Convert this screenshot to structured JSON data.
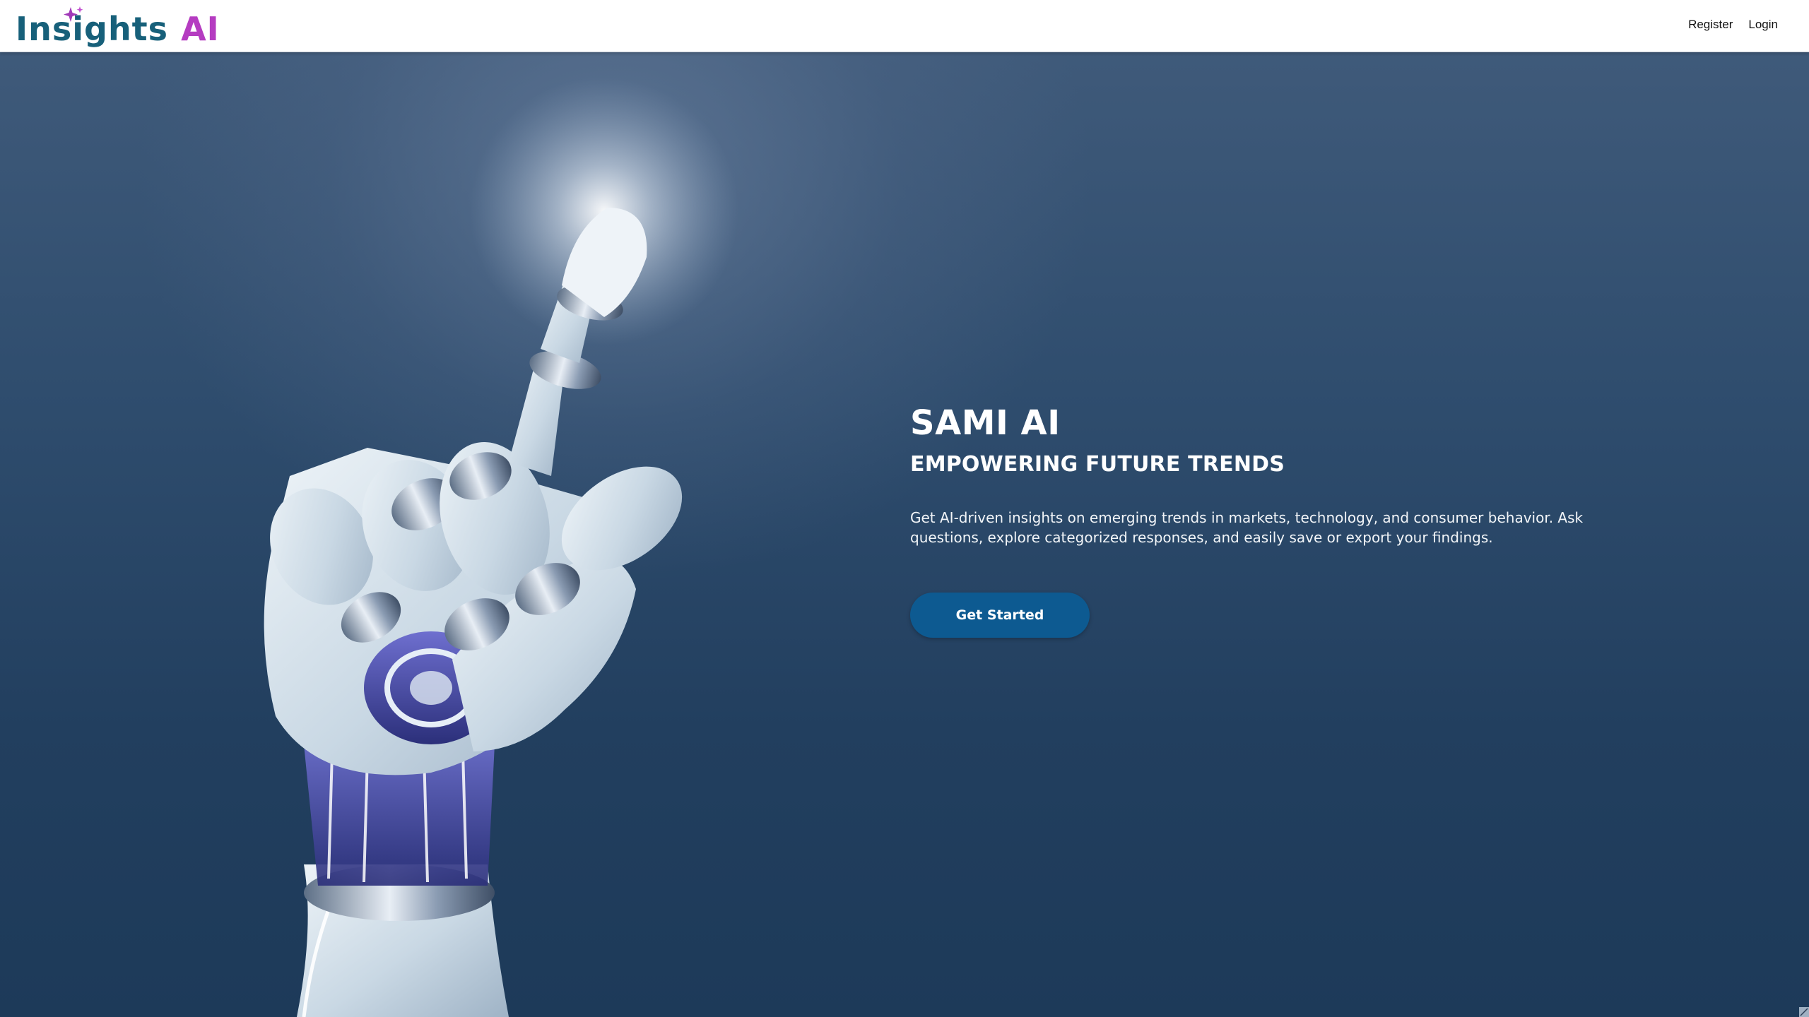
{
  "navbar": {
    "logo": {
      "word": "Insights",
      "accent": "AI",
      "word_color": "#17607a",
      "accent_color": "#b53cc1",
      "icon": "sparkle-icon"
    },
    "links": [
      {
        "label": "Register"
      },
      {
        "label": "Login"
      }
    ]
  },
  "hero": {
    "title": "SAMI AI",
    "subtitle": "EMPOWERING FUTURE TRENDS",
    "description": "Get AI-driven insights on emerging trends in markets, technology, and consumer behavior. Ask questions, explore categorized responses, and easily save or export your findings.",
    "cta_label": "Get Started",
    "cta_color": "#0d5a91",
    "background_colors": [
      "#3f5a7a",
      "#1d3a59"
    ],
    "illustration": "robot-hand-pointing-icon"
  }
}
